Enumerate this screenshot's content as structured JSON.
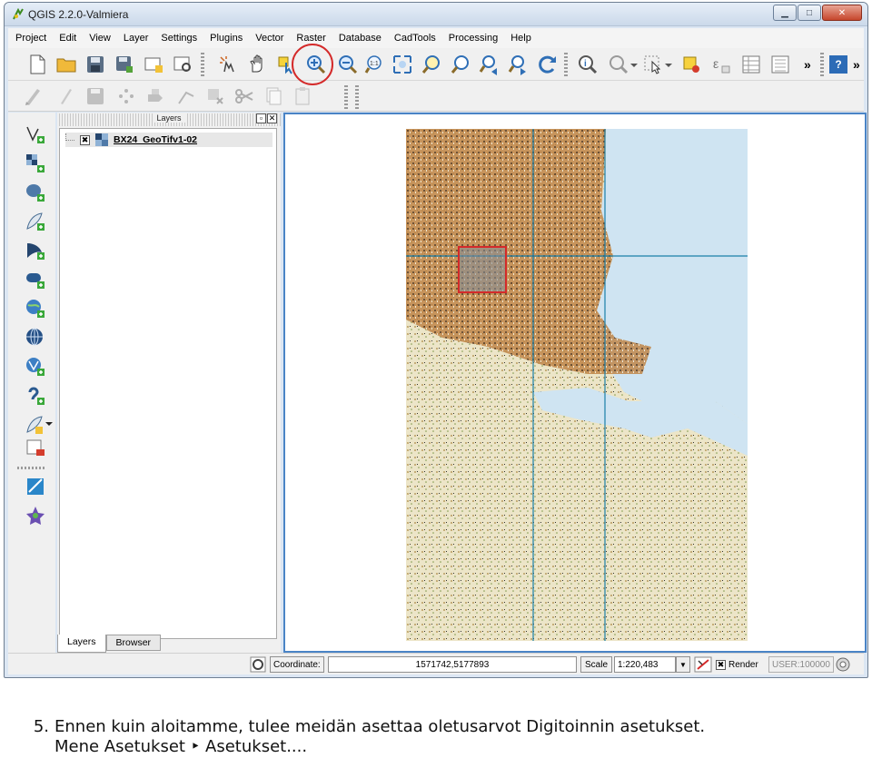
{
  "window": {
    "title": "QGIS 2.2.0-Valmiera",
    "controls": [
      "minimize",
      "maximize",
      "close"
    ]
  },
  "menubar": {
    "items": [
      "Project",
      "Edit",
      "View",
      "Layer",
      "Settings",
      "Plugins",
      "Vector",
      "Raster",
      "Database",
      "CadTools",
      "Processing",
      "Help"
    ]
  },
  "toolbar": {
    "overflow_label": "»",
    "help_label": "?",
    "highlighted_tool": "zoom-in-icon",
    "highlight_color": "#d42a2a"
  },
  "layers_panel": {
    "title": "Layers",
    "layers": [
      {
        "name": "BX24_GeoTifv1-02",
        "checked": true
      }
    ],
    "tabs": [
      "Layers",
      "Browser"
    ],
    "active_tab": "Layers"
  },
  "map": {
    "grid_color": "#1a7fa8",
    "water_color": "#cfe4f2",
    "land_color": "#e9e2c4",
    "urban_color": "#b8783a",
    "selection_color": "#d42a2a",
    "accent_border": "#4a84c6"
  },
  "statusbar": {
    "coordinate_label": "Coordinate:",
    "coordinate_value": "1571742,5177893",
    "scale_label": "Scale",
    "scale_value": "1:220,483",
    "render_label": "Render",
    "render_checked": true,
    "crs_label": "USER:100000"
  },
  "caption": {
    "number": "5.",
    "line1": "Ennen kuin aloitamme, tulee meidän asettaa oletusarvot Digitoinnin asetukset.",
    "line2": "Mene Asetukset ‣ Asetukset...."
  }
}
